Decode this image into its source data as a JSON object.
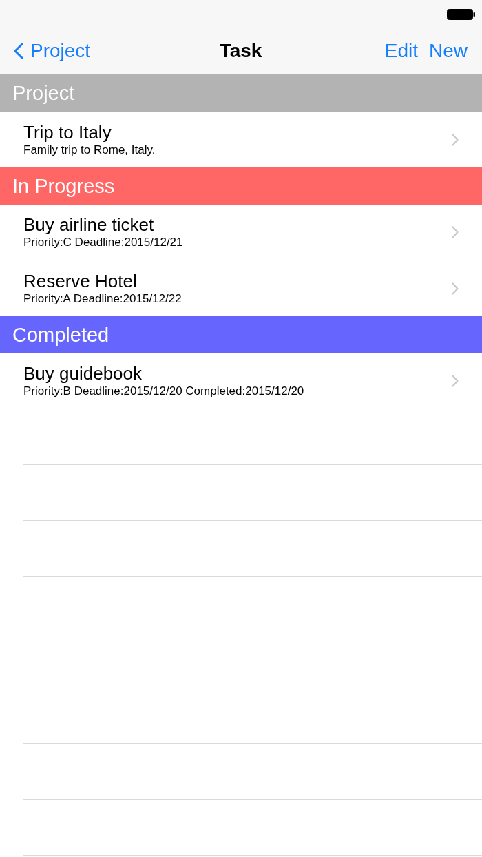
{
  "nav_bar": {
    "back": "Project",
    "title": "Task",
    "actions": [
      "Edit",
      "New"
    ]
  },
  "sections": [
    {
      "title": "Project",
      "color": "#b3b3b3",
      "rows": [
        {
          "title": "Trip to Italy",
          "subtitle": "Family trip to Rome, Italy."
        }
      ]
    },
    {
      "title": "In Progress",
      "color": "#ff6666",
      "rows": [
        {
          "title": "Buy airline ticket",
          "subtitle": "Priority:C Deadline:2015/12/21"
        },
        {
          "title": "Reserve Hotel",
          "subtitle": "Priority:A Deadline:2015/12/22"
        }
      ]
    },
    {
      "title": "Completed",
      "color": "#6666ff",
      "rows": [
        {
          "title": "Buy guidebook",
          "subtitle": "Priority:B Deadline:2015/12/20 Completed:2015/12/20"
        }
      ]
    }
  ]
}
